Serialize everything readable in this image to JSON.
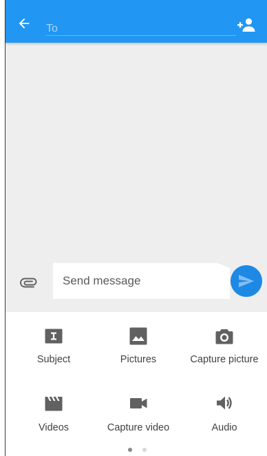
{
  "header": {
    "to_placeholder": "To",
    "back_icon": "arrow-back-icon",
    "add_contact_icon": "person-add-icon"
  },
  "composer": {
    "attach_icon": "paperclip-icon",
    "message_placeholder": "Send message",
    "send_icon": "send-icon"
  },
  "attachments": {
    "options": [
      {
        "label": "Subject",
        "icon": "subject-icon"
      },
      {
        "label": "Pictures",
        "icon": "image-icon"
      },
      {
        "label": "Capture picture",
        "icon": "camera-icon"
      },
      {
        "label": "Videos",
        "icon": "video-clip-icon"
      },
      {
        "label": "Capture video",
        "icon": "videocam-icon"
      },
      {
        "label": "Audio",
        "icon": "volume-icon"
      }
    ],
    "pages": {
      "count": 2,
      "active": 1
    }
  },
  "colors": {
    "accent": "#2196f3",
    "send_button": "#1e88e5",
    "background": "#eeeeee",
    "icon": "#616161"
  }
}
